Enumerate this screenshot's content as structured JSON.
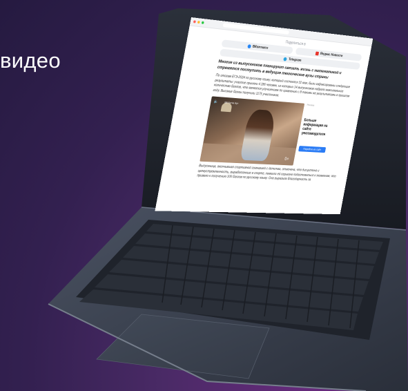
{
  "headline": "видео",
  "browser": {
    "share_title": "Поделиться в",
    "share": [
      {
        "label": "ВКонтакте",
        "icon": "vk-icon",
        "color": "#2787f5"
      },
      {
        "label": "Яндекс Новости",
        "icon": "yandex-news-icon",
        "color": "#e8352c"
      },
      {
        "label": "Telegram",
        "icon": "telegram-icon",
        "color": "#2aa3df"
      }
    ],
    "lead": "Многие из выпускников планируют связать жизнь с математикой и стремятся поступить в ведущие технические вузы страны",
    "para1": "По итогам ЕГЭ-2024 по русскому языку, который состоялся 31 мая, были зафиксированы следующие результаты: участие приняли 4 286 человек, из которых 14 выпускников набрали максимальное количество баллов, что является улучшением по сравнению с 8 такими же результатами в прошлом году. Высокие баллы получили 1175 участников.",
    "video": {
      "label": "ВВ Бутик Арт",
      "counter": "0+"
    },
    "ad": {
      "small": "Реклама",
      "title": "Больше информации на сайте рекламодателя",
      "cta": "Перейти на сайт"
    },
    "para2": "Выпускница, окончившая спортивной гимназией с детства, отмечена, что дисциплина и целеустремленность, выработанные в спорте, помогли ей серьезно подготовиться к экзаменам, что привело к получению 100 баллов по русскому языку. Она выразила благодарность за"
  },
  "colors": {
    "accent": "#2b7cf5",
    "background": "#332050"
  }
}
